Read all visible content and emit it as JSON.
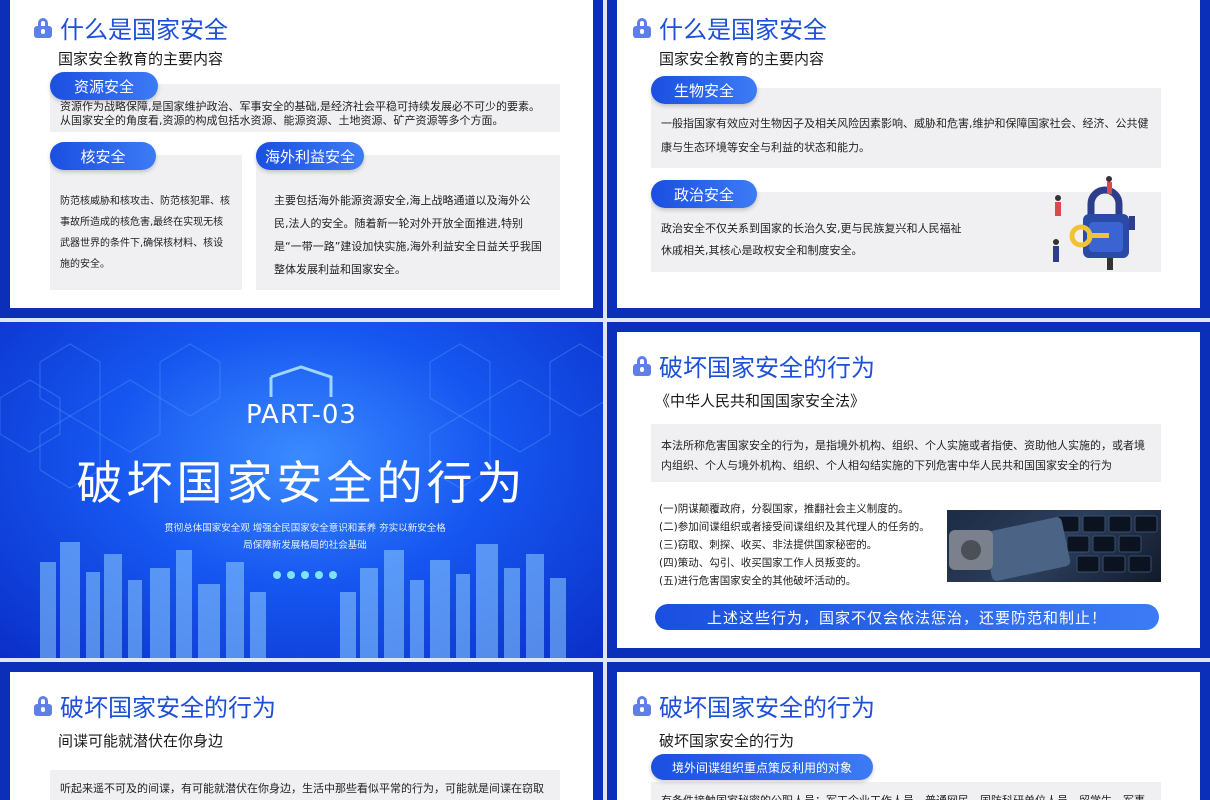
{
  "slide1": {
    "title": "什么是国家安全",
    "subtitle": "国家安全教育的主要内容",
    "pill_resource": "资源安全",
    "text_resource": "资源作为战略保障,是国家维护政治、军事安全的基础,是经济社会平稳可持续发展必不可少的要素。从国家安全的角度看,资源的构成包括水资源、能源资源、土地资源、矿产资源等多个方面。",
    "pill_nuclear": "核安全",
    "text_nuclear": "防范核威胁和核攻击、防范核犯罪、核事故所造成的核危害,最终在实现无核武器世界的条件下,确保核材料、核设施的安全。",
    "pill_overseas": "海外利益安全",
    "text_overseas": "主要包括海外能源资源安全,海上战略通道以及海外公民,法人的安全。随着新一轮对外开放全面推进,特别是“一带一路”建设加快实施,海外利益安全日益关乎我国整体发展利益和国家安全。"
  },
  "slide2": {
    "title": "什么是国家安全",
    "subtitle": "国家安全教育的主要内容",
    "pill_bio": "生物安全",
    "text_bio": "一般指国家有效应对生物因子及相关风险因素影响、威胁和危害,维护和保障国家社会、经济、公共健康与生态环境等安全与利益的状态和能力。",
    "pill_political": "政治安全",
    "text_political": "政治安全不仅关系到国家的长治久安,更与民族复兴和人民福祉休戚相关,其核心是政权安全和制度安全。"
  },
  "slide3": {
    "part": "PART-03",
    "title": "破坏国家安全的行为",
    "sub": "贯彻总体国家安全观 增强全民国家安全意识和素养 夯实以新安全格局保障新发展格局的社会基础"
  },
  "slide4": {
    "title": "破坏国家安全的行为",
    "law": "《中华人民共和国国家安全法》",
    "text_law": "本法所称危害国家安全的行为，是指境外机构、组织、个人实施或者指使、资助他人实施的，或者境内组织、个人与境外机构、组织、个人相勾结实施的下列危害中华人民共和国国家安全的行为",
    "items": [
      "(一)阴谋颠覆政府，分裂国家，推翻社会主义制度的。",
      "(二)参加间谍组织或者接受间谍组织及其代理人的任务的。",
      "(三)窃取、刺探、收买、非法提供国家秘密的。",
      "(四)策动、勾引、收买国家工作人员叛变的。",
      "(五)进行危害国家安全的其他破坏活动的。"
    ],
    "banner": "上述这些行为，国家不仅会依法惩治，还要防范和制止！"
  },
  "slide5": {
    "title": "破坏国家安全的行为",
    "subtitle": "间谍可能就潜伏在你身边",
    "text": "听起来遥不可及的间谍，有可能就潜伏在你身边，生活中那些看似平常的行为，可能就是间谍在窃取"
  },
  "slide6": {
    "title": "破坏国家安全的行为",
    "subtitle": "破坏国家安全的行为",
    "pill": "境外间谍组织重点策反利用的对象",
    "text": "有条件接触国家秘密的公职人员：军工企业工作人员、普通网民、国防科研单位人员、留学生、军事"
  }
}
